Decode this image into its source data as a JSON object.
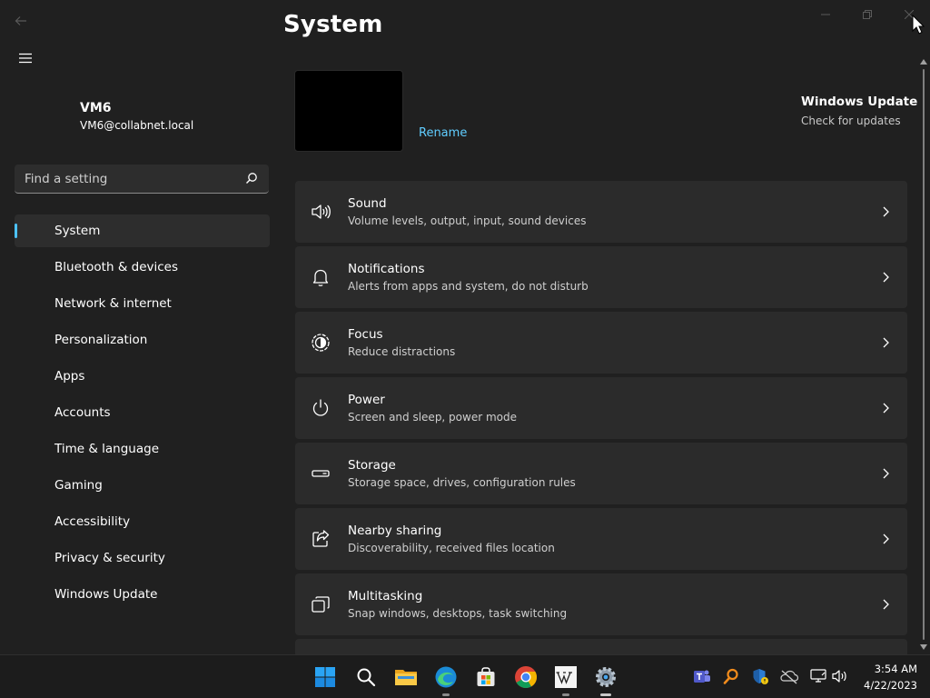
{
  "window": {
    "title": "System",
    "controls": [
      "minimize",
      "maximize",
      "close"
    ]
  },
  "account": {
    "name": "VM6",
    "email": "VM6@collabnet.local"
  },
  "search": {
    "placeholder": "Find a setting",
    "value": ""
  },
  "sidebar": {
    "items": [
      {
        "label": "System",
        "active": true
      },
      {
        "label": "Bluetooth & devices",
        "active": false
      },
      {
        "label": "Network & internet",
        "active": false
      },
      {
        "label": "Personalization",
        "active": false
      },
      {
        "label": "Apps",
        "active": false
      },
      {
        "label": "Accounts",
        "active": false
      },
      {
        "label": "Time & language",
        "active": false
      },
      {
        "label": "Gaming",
        "active": false
      },
      {
        "label": "Accessibility",
        "active": false
      },
      {
        "label": "Privacy & security",
        "active": false
      },
      {
        "label": "Windows Update",
        "active": false
      }
    ]
  },
  "header": {
    "rename_label": "Rename",
    "windows_update_title": "Windows Update",
    "windows_update_subtitle": "Check for updates"
  },
  "cards": [
    {
      "icon": "speaker-icon",
      "title": "Sound",
      "subtitle": "Volume levels, output, input, sound devices"
    },
    {
      "icon": "bell-icon",
      "title": "Notifications",
      "subtitle": "Alerts from apps and system, do not disturb"
    },
    {
      "icon": "focus-icon",
      "title": "Focus",
      "subtitle": "Reduce distractions"
    },
    {
      "icon": "power-icon",
      "title": "Power",
      "subtitle": "Screen and sleep, power mode"
    },
    {
      "icon": "storage-icon",
      "title": "Storage",
      "subtitle": "Storage space, drives, configuration rules"
    },
    {
      "icon": "share-icon",
      "title": "Nearby sharing",
      "subtitle": "Discoverability, received files location"
    },
    {
      "icon": "multitasking-icon",
      "title": "Multitasking",
      "subtitle": "Snap windows, desktops, task switching"
    }
  ],
  "taskbar": {
    "apps": [
      "start-icon",
      "search-icon",
      "file-explorer-icon",
      "edge-icon",
      "store-icon",
      "chrome-icon",
      "wikipedia-icon",
      "settings-icon"
    ],
    "tray": [
      "teams-icon",
      "magnifier-icon",
      "defender-icon",
      "onedrive-icon",
      "network-icon",
      "volume-icon"
    ],
    "time": "3:54 AM",
    "date": "4/22/2023"
  },
  "colors": {
    "background": "#202020",
    "card": "#2b2b2b",
    "accent": "#4cc2ff",
    "link": "#60cdff",
    "taskbar": "#1c1c1c"
  }
}
